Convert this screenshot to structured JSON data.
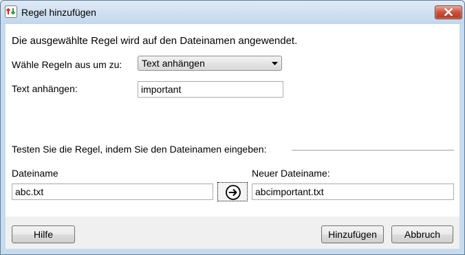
{
  "window": {
    "title": "Regel hinzufügen"
  },
  "main": {
    "heading": "Die ausgewählte Regel wird auf den Dateinamen angewendet.",
    "rule_label": "Wähle Regeln aus um zu:",
    "rule_selected": "Text anhängen",
    "text_label": "Text anhängen:",
    "text_value": "important"
  },
  "test": {
    "group_label": "Testen Sie die Regel, indem Sie den Dateinamen eingeben:",
    "filename_label": "Dateiname",
    "filename_value": "abc.txt",
    "new_filename_label": "Neuer Dateiname:",
    "new_filename_value": "abcimportant.txt"
  },
  "footer": {
    "help_label": "Hilfe",
    "add_label": "Hinzufügen",
    "cancel_label": "Abbruch"
  },
  "icons": {
    "app": "app-icon",
    "close": "close-icon",
    "dropdown": "chevron-down-icon",
    "preview": "arrow-right-circle-icon"
  },
  "colors": {
    "titlebar": "#c2d6ec",
    "close_button": "#c9503a",
    "app_icon_red": "#d0352b",
    "app_icon_green": "#2f9a3a"
  }
}
